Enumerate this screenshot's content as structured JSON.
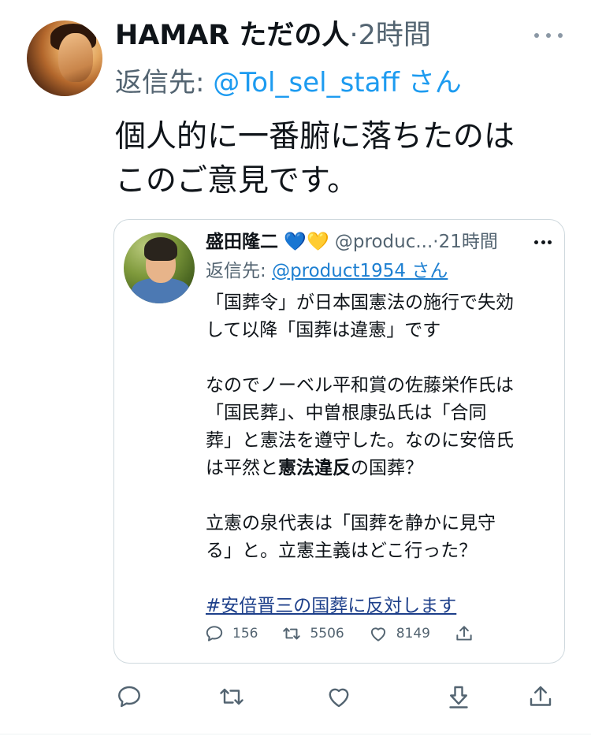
{
  "author": {
    "name": "HAMAR ただの人",
    "separator": "·",
    "time": "2時間"
  },
  "reply": {
    "prefix": "返信先: ",
    "handle": "@Tol_sel_staff",
    "suffix": " さん"
  },
  "text": {
    "line1": "個人的に一番腑に落ちたのは",
    "line2": "このご意見です。"
  },
  "quote": {
    "name": "盛田隆二",
    "emoji_blue": "💙",
    "emoji_yellow": "💛",
    "handle": "@produc...",
    "separator": "·",
    "time": "21時間",
    "reply_prefix": "返信先: ",
    "reply_handle": "@product1954 さん",
    "p1_line1": "「国葬令」が日本国憲法の施行で失効",
    "p1_line2": "して以降「国葬は違憲」です",
    "p2_line1": "なのでノーベル平和賞の佐藤栄作氏は",
    "p2_line2": "「国民葬」、中曽根康弘氏は「合同",
    "p2_line3": "葬」と憲法を遵守した。なのに安倍氏",
    "p2_line4_pre": "は平然と",
    "p2_line4_bold": "憲法違反",
    "p2_line4_post": "の国葬？",
    "p3_line1": "立憲の泉代表は「国葬を静かに見守",
    "p3_line2": "る」と。立憲主義はどこ行った？",
    "hashtag": "#安倍晋三の国葬に反対します",
    "counts": {
      "replies": "156",
      "retweets": "5506",
      "likes": "8149"
    }
  },
  "icons": {
    "reply": "reply-icon",
    "retweet": "retweet-icon",
    "like": "heart-icon",
    "download": "download-icon",
    "share": "share-icon",
    "more": "more-icon"
  },
  "colors": {
    "link": "#1d9bf0",
    "secondary_text": "#536471",
    "border": "#cfd9de"
  }
}
